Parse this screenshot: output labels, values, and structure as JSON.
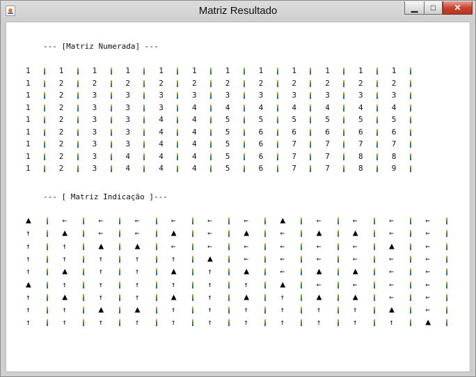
{
  "window": {
    "title": "Matriz Resultado",
    "controls": {
      "minimize": "▁",
      "maximize": "□",
      "close": "✕"
    }
  },
  "numerada": {
    "title": "--- [Matriz Numerada] ---",
    "rows": [
      [
        "1",
        "1",
        "1",
        "1",
        "1",
        "1",
        "1",
        "1",
        "1",
        "1",
        "1",
        "1"
      ],
      [
        "1",
        "2",
        "2",
        "2",
        "2",
        "2",
        "2",
        "2",
        "2",
        "2",
        "2",
        "2"
      ],
      [
        "1",
        "2",
        "3",
        "3",
        "3",
        "3",
        "3",
        "3",
        "3",
        "3",
        "3",
        "3"
      ],
      [
        "1",
        "2",
        "3",
        "3",
        "3",
        "4",
        "4",
        "4",
        "4",
        "4",
        "4",
        "4"
      ],
      [
        "1",
        "2",
        "3",
        "3",
        "4",
        "4",
        "5",
        "5",
        "5",
        "5",
        "5",
        "5"
      ],
      [
        "1",
        "2",
        "3",
        "3",
        "4",
        "4",
        "5",
        "6",
        "6",
        "6",
        "6",
        "6"
      ],
      [
        "1",
        "2",
        "3",
        "3",
        "4",
        "4",
        "5",
        "6",
        "7",
        "7",
        "7",
        "7"
      ],
      [
        "1",
        "2",
        "3",
        "4",
        "4",
        "4",
        "5",
        "6",
        "7",
        "7",
        "8",
        "8"
      ],
      [
        "1",
        "2",
        "3",
        "4",
        "4",
        "4",
        "5",
        "6",
        "7",
        "7",
        "8",
        "9"
      ]
    ]
  },
  "indicacao": {
    "title": "--- [ Matriz Indicação ]---",
    "rows": [
      [
        "▲",
        "←",
        "←",
        "←",
        "←",
        "←",
        "←",
        "▲",
        "←",
        "←",
        "←",
        "←"
      ],
      [
        "↑",
        "▲",
        "←",
        "←",
        "▲",
        "←",
        "▲",
        "←",
        "▲",
        "▲",
        "←",
        "←"
      ],
      [
        "↑",
        "↑",
        "▲",
        "▲",
        "←",
        "←",
        "←",
        "←",
        "←",
        "←",
        "▲",
        "←"
      ],
      [
        "↑",
        "↑",
        "↑",
        "↑",
        "↑",
        "▲",
        "←",
        "←",
        "←",
        "←",
        "←",
        "←"
      ],
      [
        "↑",
        "▲",
        "↑",
        "↑",
        "▲",
        "↑",
        "▲",
        "←",
        "▲",
        "▲",
        "←",
        "←"
      ],
      [
        "▲",
        "↑",
        "↑",
        "↑",
        "↑",
        "↑",
        "↑",
        "▲",
        "←",
        "←",
        "←",
        "←"
      ],
      [
        "↑",
        "▲",
        "↑",
        "↑",
        "▲",
        "↑",
        "▲",
        "↑",
        "▲",
        "▲",
        "←",
        "←"
      ],
      [
        "↑",
        "↑",
        "▲",
        "▲",
        "↑",
        "↑",
        "↑",
        "↑",
        "↑",
        "↑",
        "▲",
        "←"
      ],
      [
        "↑",
        "↑",
        "↑",
        "↑",
        "↑",
        "↑",
        "↑",
        "↑",
        "↑",
        "↑",
        "↑",
        "▲"
      ]
    ]
  }
}
